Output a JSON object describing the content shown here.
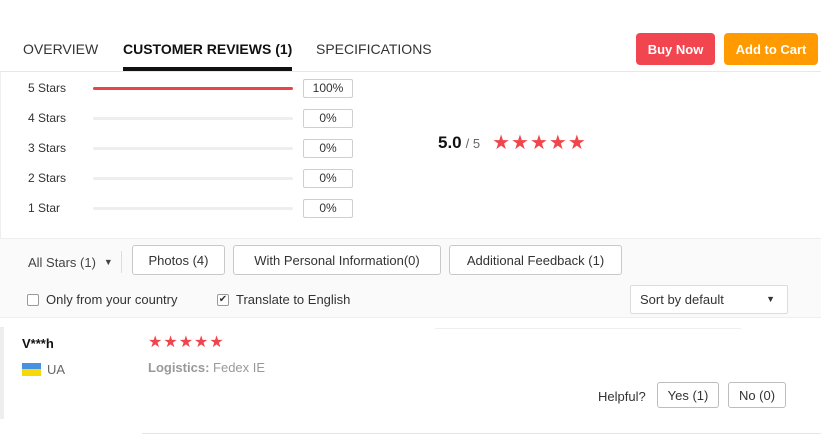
{
  "tabs": [
    {
      "label": "OVERVIEW",
      "active": false
    },
    {
      "label": "CUSTOMER REVIEWS (1)",
      "active": true
    },
    {
      "label": "SPECIFICATIONS",
      "active": false
    }
  ],
  "actions": {
    "buy_now": "Buy Now",
    "add_to_cart": "Add to Cart",
    "colors": {
      "buy_now": "#f1454f",
      "add_to_cart": "#ff9a00"
    }
  },
  "rating_breakdown": [
    {
      "label": "5 Stars",
      "percent_text": "100%",
      "fraction": 1.0
    },
    {
      "label": "4 Stars",
      "percent_text": "0%",
      "fraction": 0
    },
    {
      "label": "3 Stars",
      "percent_text": "0%",
      "fraction": 0
    },
    {
      "label": "2 Stars",
      "percent_text": "0%",
      "fraction": 0
    },
    {
      "label": "1 Star",
      "percent_text": "0%",
      "fraction": 0
    }
  ],
  "average": {
    "value": "5.0",
    "out_of": "/ 5",
    "stars_filled": 5,
    "star_color": "#f0454a"
  },
  "filters": {
    "star_dropdown": "All Stars (1)",
    "photos": "Photos (4)",
    "personal_info": "With Personal Information(0)",
    "additional_feedback": "Additional Feedback (1)",
    "only_country": {
      "label": "Only from your country",
      "checked": false
    },
    "translate": {
      "label": "Translate to English",
      "checked": true
    },
    "sort": "Sort by default"
  },
  "reviews": [
    {
      "user": "V***h",
      "country": "UA",
      "stars": 5,
      "logistics_label": "Logistics:",
      "logistics_value": "Fedex IE",
      "helpful_label": "Helpful?",
      "yes": "Yes (1)",
      "no": "No (0)"
    }
  ],
  "icons": {
    "star": "star-icon",
    "chevron": "chevron-down-icon",
    "check": "check-icon",
    "flag": "ukraine-flag-icon"
  }
}
